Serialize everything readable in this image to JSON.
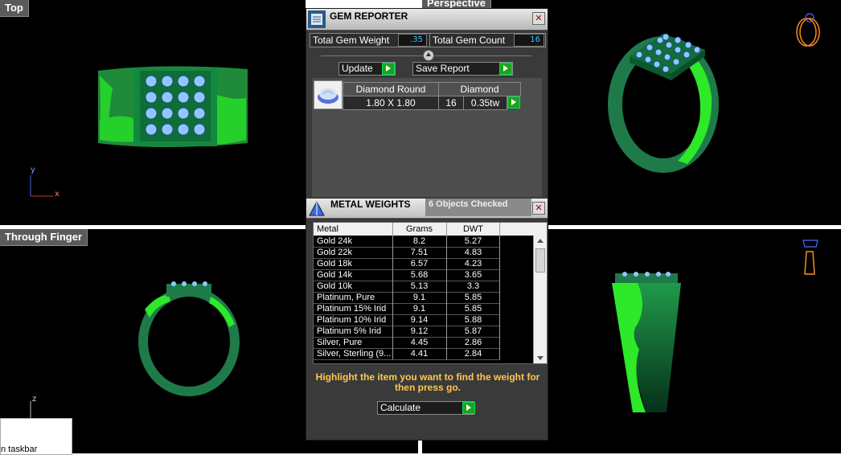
{
  "viewports": {
    "top": {
      "label": "Top",
      "axis_y": "y",
      "axis_x": "x"
    },
    "perspective": {
      "label": "Perspective"
    },
    "through_finger": {
      "label": "Through Finger",
      "axis_z": "z"
    },
    "side": {
      "label": ""
    }
  },
  "taskbar_tip": {
    "text": "n taskbar"
  },
  "gem_reporter": {
    "title": "GEM REPORTER",
    "close_label": "✕",
    "total_weight_label": "Total Gem Weight",
    "total_weight_value": ".35",
    "total_count_label": "Total Gem Count",
    "total_count_value": "16",
    "update_label": "Update",
    "save_report_label": "Save Report",
    "gems": [
      {
        "cut": "Diamond Round",
        "stone": "Diamond",
        "size": "1.80 X 1.80",
        "count": "16",
        "weight": "0.35tw"
      }
    ]
  },
  "metal_weights": {
    "title": "METAL WEIGHTS",
    "status": "6 Objects Checked",
    "close_label": "✕",
    "columns": [
      "Metal",
      "Grams",
      "DWT"
    ],
    "rows": [
      {
        "metal": "Gold 24k",
        "grams": "8.2",
        "dwt": "5.27"
      },
      {
        "metal": "Gold 22k",
        "grams": "7.51",
        "dwt": "4.83"
      },
      {
        "metal": "Gold 18k",
        "grams": "6.57",
        "dwt": "4.23"
      },
      {
        "metal": "Gold 14k",
        "grams": "5.68",
        "dwt": "3.65"
      },
      {
        "metal": "Gold 10k",
        "grams": "5.13",
        "dwt": "3.3"
      },
      {
        "metal": "Platinum, Pure",
        "grams": "9.1",
        "dwt": "5.85"
      },
      {
        "metal": "Platinum 15% Irid",
        "grams": "9.1",
        "dwt": "5.85"
      },
      {
        "metal": "Platinum 10% Irid",
        "grams": "9.14",
        "dwt": "5.88"
      },
      {
        "metal": "Platinum 5% Irid",
        "grams": "9.12",
        "dwt": "5.87"
      },
      {
        "metal": "Silver, Pure",
        "grams": "4.45",
        "dwt": "2.86"
      },
      {
        "metal": "Silver, Sterling (9...",
        "grams": "4.41",
        "dwt": "2.84"
      }
    ],
    "hint": "Highlight the item you want to find the weight for then press go.",
    "calculate_label": "Calculate"
  },
  "colors": {
    "ring_dark": "#1f7a4a",
    "ring_bright": "#2ee82a",
    "gem_blue": "#8fc8ff",
    "accent_orange": "#ffc84a",
    "value_cyan": "#2fc9ff"
  }
}
